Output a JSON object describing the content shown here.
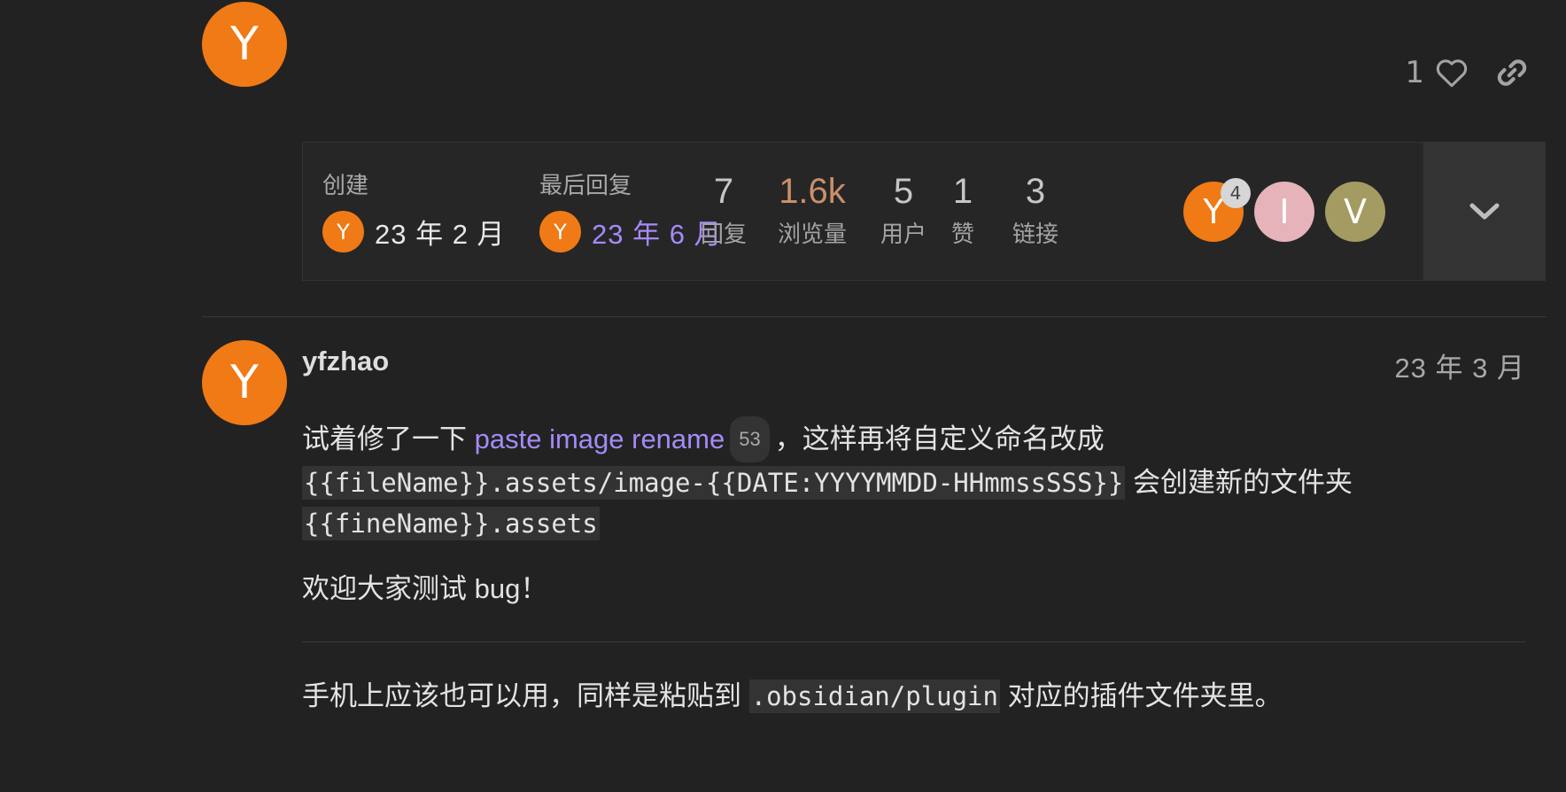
{
  "top_post": {
    "avatar_letter": "Y",
    "like_count": "1",
    "avatar_color": "#f07a15"
  },
  "topic_map": {
    "created_label": "创建",
    "created_avatar": "Y",
    "created_date": "23 年 2 月",
    "last_reply_label": "最后回复",
    "last_reply_avatar": "Y",
    "last_reply_date": "23 年 6 月",
    "stats": [
      {
        "num": "7",
        "label": "回复"
      },
      {
        "num": "1.6k",
        "label": "浏览量"
      },
      {
        "num": "5",
        "label": "用户"
      },
      {
        "num": "1",
        "label": "赞"
      },
      {
        "num": "3",
        "label": "链接"
      }
    ],
    "participants": [
      {
        "letter": "Y",
        "count": "4",
        "color": "#f07a15"
      },
      {
        "letter": "I",
        "color": "#e5b3b9"
      },
      {
        "letter": "V",
        "color": "#a39b62"
      }
    ],
    "accent_link_color": "#a58af8",
    "hot_views_color": "#c8906a"
  },
  "post": {
    "avatar_letter": "Y",
    "username": "yfzhao",
    "date": "23 年 3 月",
    "line1_prefix": "试着修了一下 ",
    "link_text": "paste image rename",
    "link_clicks": "53",
    "line1_suffix": "，这样再将自定义命名改成",
    "code1": "{{fileName}}.assets/image-{{DATE:YYYYMMDD-HHmmssSSS}}",
    "line2_suffix": " 会创建新的文件夹",
    "code2": "{{fineName}}.assets",
    "para2": "欢迎大家测试 bug！",
    "para3_prefix": "手机上应该也可以用，同样是粘贴到 ",
    "code3": ".obsidian/plugin",
    "para3_suffix": " 对应的插件文件夹里。"
  }
}
